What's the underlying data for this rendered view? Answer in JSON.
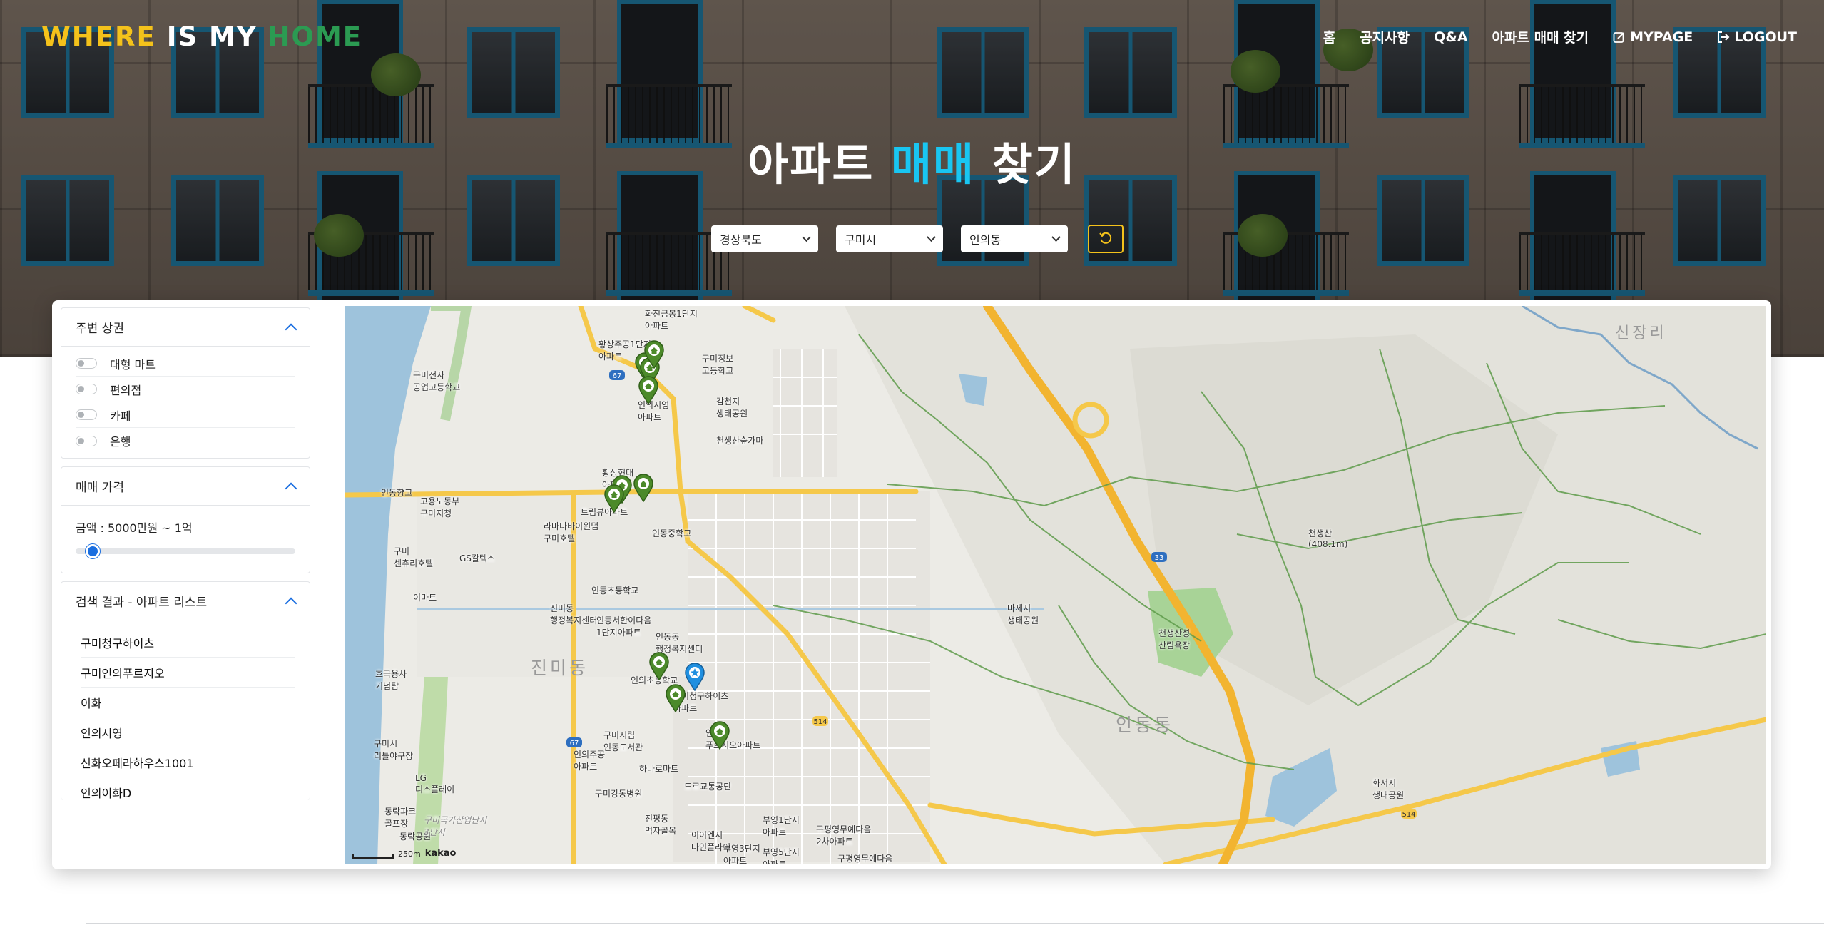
{
  "logo": {
    "part1": "WHERE",
    "part2": "IS MY",
    "part3": "HOME"
  },
  "nav": {
    "home": "홈",
    "notice": "공지사항",
    "qna": "Q&A",
    "apt_search": "아파트 매매 찾기",
    "mypage": "MYPAGE",
    "logout": "LOGOUT"
  },
  "title": {
    "part1": "아파트",
    "part2": "매매",
    "part3": "찾기"
  },
  "filters": {
    "sido": "경상북도",
    "gugun": "구미시",
    "dong": "인의동",
    "reset_icon": "refresh-icon"
  },
  "sidebar": {
    "nearby": {
      "title": "주변 상권",
      "options": [
        "대형 마트",
        "편의점",
        "카페",
        "은행"
      ]
    },
    "price": {
      "title": "매매 가격",
      "label": "금액 : 5000만원 ~ 1억",
      "slider_value": 0.05
    },
    "results": {
      "title": "검색 결과 - 아파트 리스트",
      "items": [
        "구미청구하이츠",
        "구미인의푸르지오",
        "이화",
        "인의시영",
        "신화오페라하우스1001",
        "인의이화D"
      ]
    }
  },
  "map": {
    "labels": {
      "l1": "화진금봉1단지\n아파트",
      "l2": "황상주공1단지\n아파트",
      "l3": "구미정보\n고등학교",
      "l4": "구미전자\n공업고등학교",
      "l5": "감천지\n생태공원",
      "l6": "천생산숲가마",
      "l7": "인동향교",
      "l8": "고용노동부\n구미지청",
      "l9": "황상현대\n아파트",
      "l10": "트림뷰아파트",
      "l11": "라마다바이윈덤\n구미호텔",
      "l12": "인동중학교",
      "l13": "구미\n센츄리호텔",
      "l14": "GS칼텍스",
      "l15": "이마트",
      "l16": "인동초등학교",
      "l17": "진미동\n행정복지센터",
      "l18": "인동서한이다음\n1단지아파트",
      "l19": "인동동\n행정복지센터",
      "l20": "구미청구하이츠\n아파트",
      "l21": "인의초등학교",
      "l22": "인의\n푸르지오아파트",
      "l23": "구미시립\n인동도서관",
      "l24": "인의주공\n아파트",
      "l25": "하나로마트",
      "l26": "구미강동병원",
      "l27": "도로교통공단",
      "l28": "LG\n디스플레이",
      "l29": "구미시\n리틀야구장",
      "l30": "호국용사\n기념탑",
      "l31": "동락파크\n골프장",
      "l32": "동락공원",
      "l33": "진평동\n먹자골목",
      "l34": "이이엔지\n나인플라이",
      "l35": "부영3단지\n아파트",
      "l36": "부영1단지\n아파트",
      "l37": "부영5단지\n아파트",
      "l38": "구평영무예다음\n2차아파트",
      "l39": "구평영무예다음",
      "l40": "마제지\n생태공원",
      "l41": "천생산성\n산림욕장",
      "l42": "천생산\n(408.1m)",
      "l43": "화서지\n생태공원",
      "l44": "구미국가산업단지\n3단지",
      "l45": "인의시영\n아파트"
    },
    "districts": {
      "jinmi": "진미동",
      "indong": "인동동",
      "sinjang": "신장리"
    },
    "road_numbers": {
      "r67a": "67",
      "r67b": "67",
      "r33": "33",
      "r514a": "514",
      "r514b": "514"
    },
    "scale": "250m",
    "provider": "kakao"
  },
  "colors": {
    "accent_yellow": "#f4c21b",
    "accent_cyan": "#19c6f2",
    "logo_green": "#2b9b52",
    "marker_green": "#4c8a2a",
    "marker_blue": "#1f8fe0",
    "slider_blue": "#1a6ee0"
  }
}
